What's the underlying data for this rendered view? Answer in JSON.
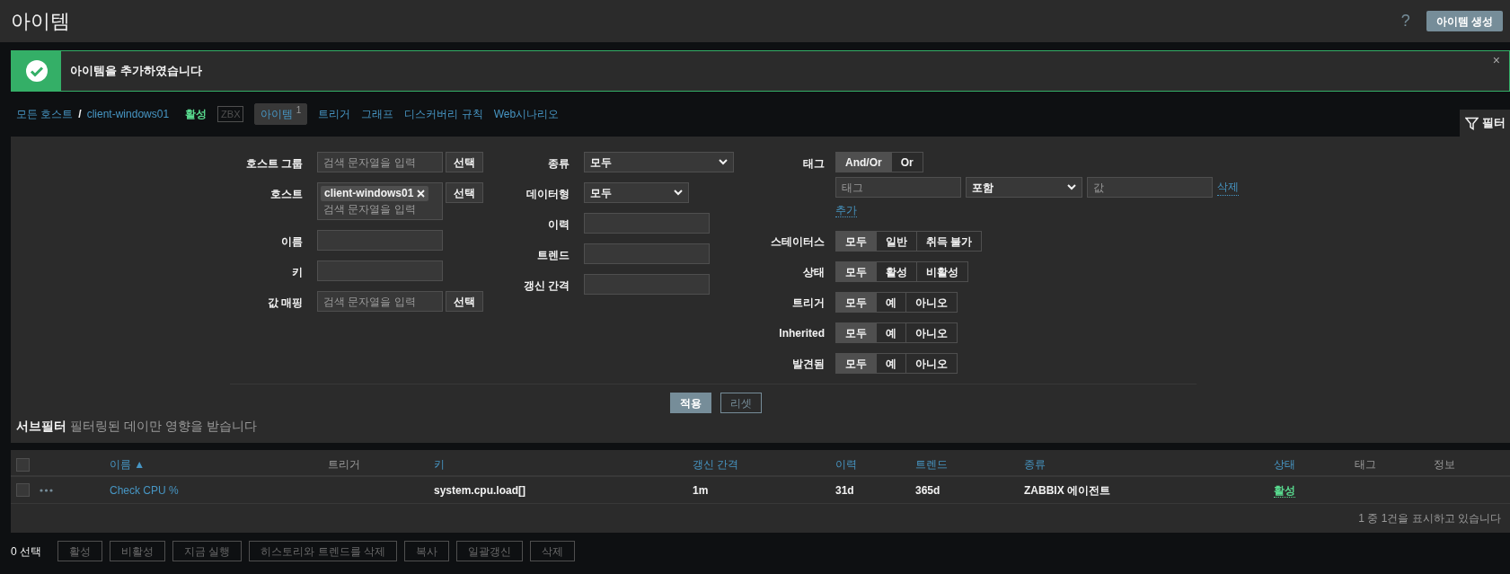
{
  "header": {
    "title": "아이템",
    "help": "?",
    "create_button": "아이템 생성"
  },
  "message": {
    "text": "아이템을 추가하였습니다",
    "close": "×"
  },
  "breadcrumb": [
    {
      "label": "모든 호스트"
    },
    {
      "label": "client-windows01"
    }
  ],
  "breadcrumb_separator": "/",
  "host_nav": [
    {
      "kind": "status",
      "label": "활성"
    },
    {
      "kind": "badge",
      "label": "ZBX"
    },
    {
      "kind": "tab",
      "label": "아이템",
      "count": "1",
      "selected": true
    },
    {
      "kind": "link",
      "label": "트리거"
    },
    {
      "kind": "link",
      "label": "그래프"
    },
    {
      "kind": "link",
      "label": "디스커버리 규칙"
    },
    {
      "kind": "link",
      "label": "Web시나리오"
    }
  ],
  "filter_tab": {
    "label": "필터",
    "selected": true
  },
  "filter": {
    "left_fields": [
      {
        "label": "호스트 그룹",
        "kind": "multiselect",
        "placeholder": "검색 문자열을 입력",
        "button": "선택"
      },
      {
        "label": "호스트",
        "kind": "multiselect",
        "chips": [
          "client-windows01"
        ],
        "placeholder": "검색 문자열을 입력",
        "button": "선택"
      },
      {
        "label": "이름",
        "kind": "text"
      },
      {
        "label": "키",
        "kind": "text"
      },
      {
        "label": "값 매핑",
        "kind": "multiselect",
        "placeholder": "검색 문자열을 입력",
        "button": "선택"
      }
    ],
    "middle_fields": [
      {
        "label": "종류",
        "kind": "select",
        "value": "모두"
      },
      {
        "label": "데이터형",
        "kind": "select",
        "value": "모두"
      },
      {
        "label": "이력",
        "kind": "text"
      },
      {
        "label": "트렌드",
        "kind": "text"
      },
      {
        "label": "갱신 간격",
        "kind": "text"
      }
    ],
    "tags": {
      "label": "태그",
      "operators": [
        {
          "label": "And/Or",
          "selected": true
        },
        {
          "label": "Or",
          "selected": false
        }
      ],
      "row": {
        "tag_placeholder": "태그",
        "condition": "포함",
        "value_placeholder": "값",
        "remove": "삭제"
      },
      "add": "추가"
    },
    "segments": [
      {
        "label": "스테이터스",
        "options": [
          {
            "label": "모두",
            "selected": true
          },
          {
            "label": "일반",
            "selected": false
          },
          {
            "label": "취득 불가",
            "selected": false
          }
        ]
      },
      {
        "label": "상태",
        "options": [
          {
            "label": "모두",
            "selected": true
          },
          {
            "label": "활성",
            "selected": false
          },
          {
            "label": "비활성",
            "selected": false
          }
        ]
      },
      {
        "label": "트리거",
        "options": [
          {
            "label": "모두",
            "selected": true
          },
          {
            "label": "예",
            "selected": false
          },
          {
            "label": "아니오",
            "selected": false
          }
        ]
      },
      {
        "label": "Inherited",
        "options": [
          {
            "label": "모두",
            "selected": true
          },
          {
            "label": "예",
            "selected": false
          },
          {
            "label": "아니오",
            "selected": false
          }
        ]
      },
      {
        "label": "발견됨",
        "options": [
          {
            "label": "모두",
            "selected": true
          },
          {
            "label": "예",
            "selected": false
          },
          {
            "label": "아니오",
            "selected": false
          }
        ]
      }
    ],
    "apply": "적용",
    "reset": "리셋"
  },
  "subfilter": {
    "title": "서브필터",
    "note": "필터링된 데이만 영향을 받습니다"
  },
  "table": {
    "select_all": {
      "checked": false
    },
    "columns": [
      {
        "label": "이름",
        "sortable": true,
        "sort_mark": "▲"
      },
      {
        "label": "트리거",
        "sortable": false
      },
      {
        "label": "키",
        "sortable": true
      },
      {
        "label": "갱신 간격",
        "sortable": true
      },
      {
        "label": "이력",
        "sortable": true
      },
      {
        "label": "트렌드",
        "sortable": true
      },
      {
        "label": "종류",
        "sortable": true
      },
      {
        "label": "상태",
        "sortable": true
      },
      {
        "label": "태그",
        "sortable": false
      },
      {
        "label": "정보",
        "sortable": false
      }
    ],
    "rows": [
      {
        "checked": false,
        "name": "Check CPU %",
        "key": "system.cpu.load[]",
        "interval": "1m",
        "history": "31d",
        "trends": "365d",
        "type": "ZABBIX 에이전트",
        "status": "활성",
        "enabled": true
      }
    ],
    "footer": "1 중 1건을 표시하고 있습니다"
  },
  "actions": {
    "selected_count": "0 선택",
    "buttons": [
      "활성",
      "비활성",
      "지금 실행",
      "히스토리와 트렌드를 삭제",
      "복사",
      "일괄갱신",
      "삭제"
    ]
  }
}
